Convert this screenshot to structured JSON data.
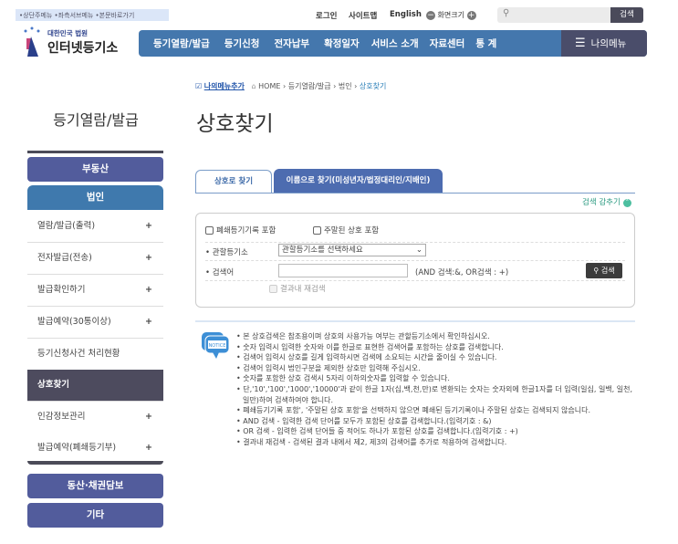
{
  "header": {
    "skip_links": "•상단주메뉴 •좌측서브메뉴 •본문바로가기",
    "login": "로그인",
    "sitemap": "사이트맵",
    "english": "English",
    "screen_size": "화면크기",
    "search_button": "검색",
    "search_placeholder": "",
    "logo_top": "대한민국 법원",
    "logo_main": "인터넷등기소",
    "nav": [
      "등기열람/발급",
      "등기신청",
      "전자납부",
      "확정일자",
      "서비스 소개",
      "자료센터",
      "통 계"
    ],
    "my_menu": "나의메뉴"
  },
  "breadcrumb": {
    "add_my_menu": "나의메뉴추가",
    "items": [
      "HOME",
      "등기열람/발급",
      "법인"
    ],
    "current": "상호찾기"
  },
  "sidebar": {
    "title": "등기열람/발급",
    "cat_realestate": "부동산",
    "cat_corp": "법인",
    "items": [
      {
        "label": "열람/발급(출력)",
        "plus": "+"
      },
      {
        "label": "전자발급(전송)",
        "plus": "+"
      },
      {
        "label": "발급확인하기",
        "plus": "+"
      },
      {
        "label": "발급예약(30통이상)",
        "plus": "+"
      },
      {
        "label": "등기신청사건 처리현황",
        "plus": ""
      },
      {
        "label": "상호찾기",
        "plus": ""
      },
      {
        "label": "인감정보관리",
        "plus": "+"
      },
      {
        "label": "발급예약(폐쇄등기부)",
        "plus": "+"
      }
    ],
    "cat_movable": "동산·채권담보",
    "cat_etc": "기타"
  },
  "main": {
    "title": "상호찾기",
    "tabs": [
      "상호로 찾기",
      "이름으로 찾기(미성년자/법정대리인/지배인)"
    ],
    "hide_search": "검색 감추기",
    "form": {
      "include_closed": "폐쇄등기기록 포함",
      "include_dormant": "주말된 상호 포함",
      "registry_label": "• 관할등기소",
      "registry_value": "관할등기소를 선택하세요",
      "keyword_label": "• 검색어",
      "keyword_value": "",
      "keyword_hint": "(AND 검색:&, OR검색 : +)",
      "search_button": "검색",
      "research": "결과내 재검색"
    },
    "notice_icon_text": "NOTICE",
    "notices": [
      "• 본 상호검색은 참조용이며 상호의 사용가능 여부는 관할등기소에서 확인하십시오.",
      "• 숫자 입력시 입력한 숫자와 이를 한글로 표현한 검색어를 포함하는 상호를 검색합니다.",
      "• 검색어 입력시 상호를 길게 입력하시면 검색에 소요되는 시간을 줄이실 수 있습니다.",
      "• 검색어 입력시 법인구분을 제외한 상호만 입력해 주십시오.",
      "• 숫자를 포함한 상호 검색시 5자리 이하의숫자를 입력할 수 있습니다.",
      "• 단,'10','100','1000','10000'과 같이 한글 1자(십,백,천,만)로 변환되는 숫자는 숫자외에 한글1자를 더 입력(일십, 일백, 일천, 일만)하여 검색하여야 합니다.",
      "• 폐쇄등기기록 포함', '주말된 상호 포함'을 선택하지 않으면 폐쇄된 등기기록이나 주말된 상호는 검색되지 않습니다.",
      "• AND 검색 - 입력한 검색 단어를 모두가 포함된 상호를 검색합니다.(입력기호 : &)",
      "• OR 검색 - 입력한 검색 단어들 중 적어도 하나가 포함된 상호를 검색합니다.(입력기호 : +)",
      "• 결과내 재검색 - 검색된 결과 내에서 제2, 제3의 검색어를 추가로 적용하여 검색합니다."
    ]
  }
}
